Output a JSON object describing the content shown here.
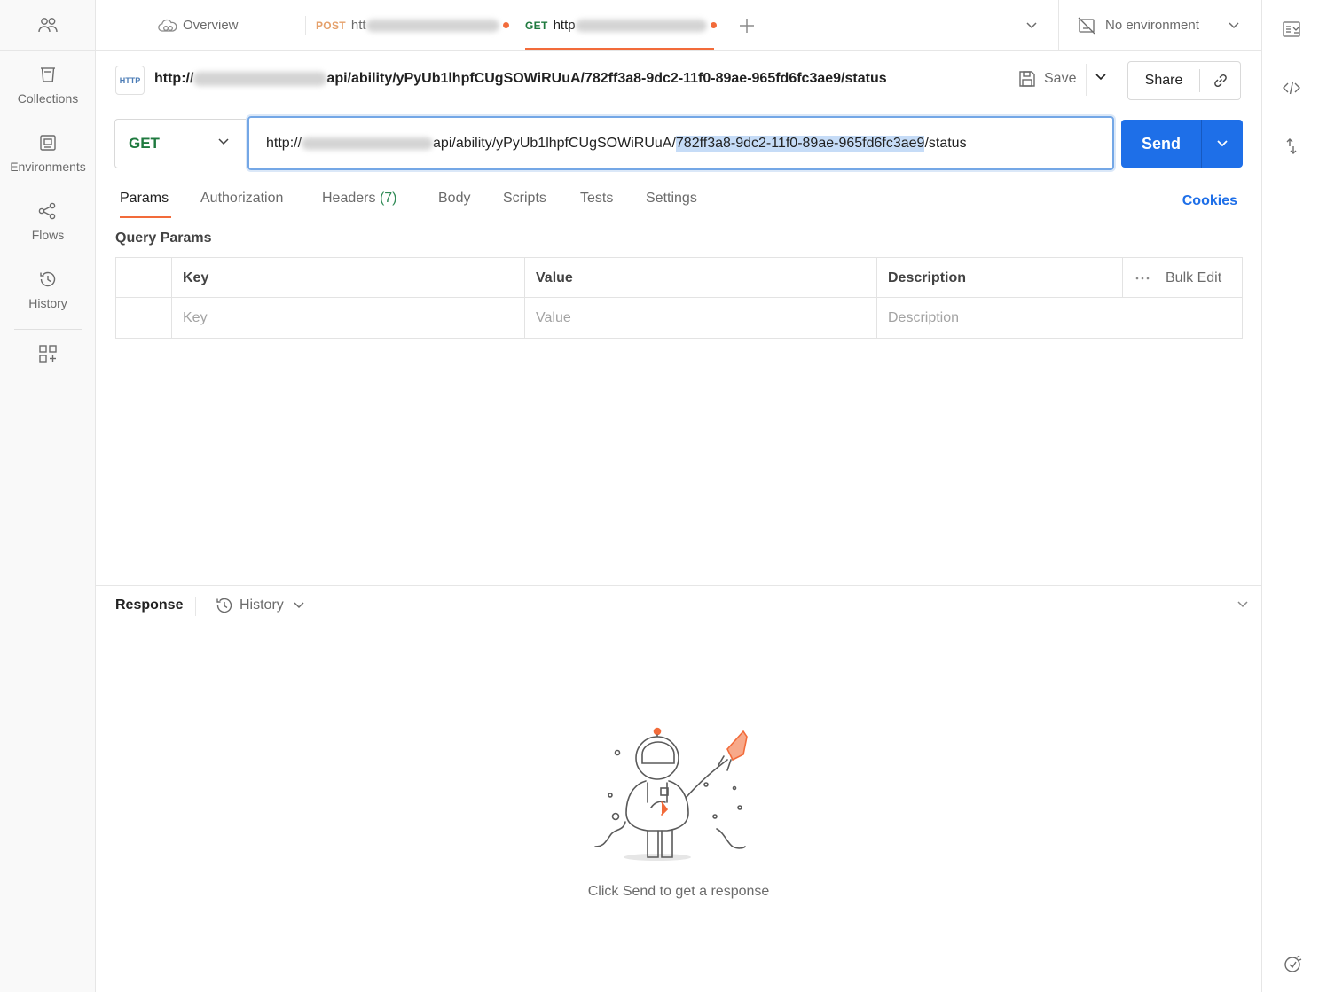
{
  "sidebar": {
    "items": [
      {
        "label": "Collections",
        "icon": "collections-icon"
      },
      {
        "label": "Environments",
        "icon": "environments-icon"
      },
      {
        "label": "Flows",
        "icon": "flows-icon"
      },
      {
        "label": "History",
        "icon": "history-icon"
      }
    ]
  },
  "tabs": {
    "overview_label": "Overview",
    "tab1": {
      "method": "POST",
      "text": "htt"
    },
    "tab2": {
      "method": "GET",
      "text": "http"
    }
  },
  "environment": {
    "label": "No environment"
  },
  "request": {
    "title_prefix": "http://",
    "title_suffix": "api/ability/yPyUb1lhpfCUgSOWiRUuA/782ff3a8-9dc2-11f0-89ae-965fd6fc3ae9/status",
    "save_label": "Save",
    "share_label": "Share",
    "method": "GET",
    "url_prefix": "http://",
    "url_mid": "api/ability/yPyUb1lhpfCUgSOWiRUuA/",
    "url_selected": "782ff3a8-9dc2-11f0-89ae-965fd6fc3ae9",
    "url_end": "/status",
    "send_label": "Send"
  },
  "req_tabs": {
    "params": "Params",
    "authorization": "Authorization",
    "headers": "Headers",
    "headers_count": "(7)",
    "body": "Body",
    "scripts": "Scripts",
    "tests": "Tests",
    "settings": "Settings",
    "cookies": "Cookies"
  },
  "query_params": {
    "title": "Query Params",
    "headers": {
      "key": "Key",
      "value": "Value",
      "description": "Description",
      "bulk_edit": "Bulk Edit"
    },
    "placeholders": {
      "key": "Key",
      "value": "Value",
      "description": "Description"
    }
  },
  "response": {
    "title": "Response",
    "history_label": "History",
    "empty_message": "Click Send to get a response"
  },
  "colors": {
    "accent": "#1e6fe8",
    "tab_indicator": "#f26b3a",
    "get_method": "#1f7a3f",
    "post_method": "#e5a06a"
  }
}
